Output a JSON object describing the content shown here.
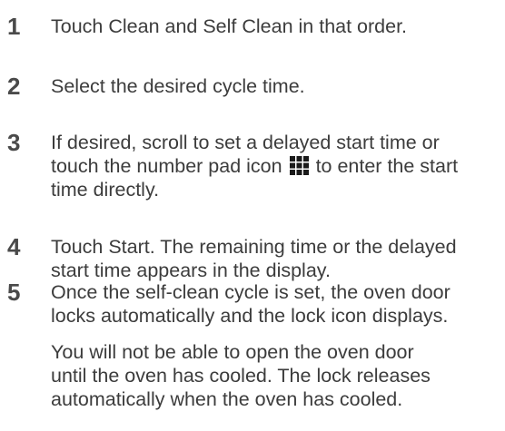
{
  "steps": [
    {
      "number": "1",
      "lines": [
        "Touch Clean and Self Clean in that order."
      ]
    },
    {
      "number": "2",
      "lines": [
        "Select the desired cycle time."
      ]
    },
    {
      "number": "3",
      "line1": "If desired, scroll to set a delayed start time or",
      "line2_before_icon": "touch the number pad icon",
      "line2_after_icon": "to enter the start",
      "line3": "time directly.",
      "icon": "number-pad-icon"
    },
    {
      "number": "4",
      "lines": [
        "Touch Start. The remaining time or the delayed",
        "start time appears in the display."
      ]
    },
    {
      "number": "5",
      "lines": [
        "Once the self-clean cycle is set, the oven door",
        "locks automatically and the lock icon displays."
      ]
    }
  ],
  "note": {
    "lines": [
      "You will not be able to open the oven door",
      "until the oven has cooled. The lock releases",
      "automatically when the oven has cooled."
    ]
  }
}
